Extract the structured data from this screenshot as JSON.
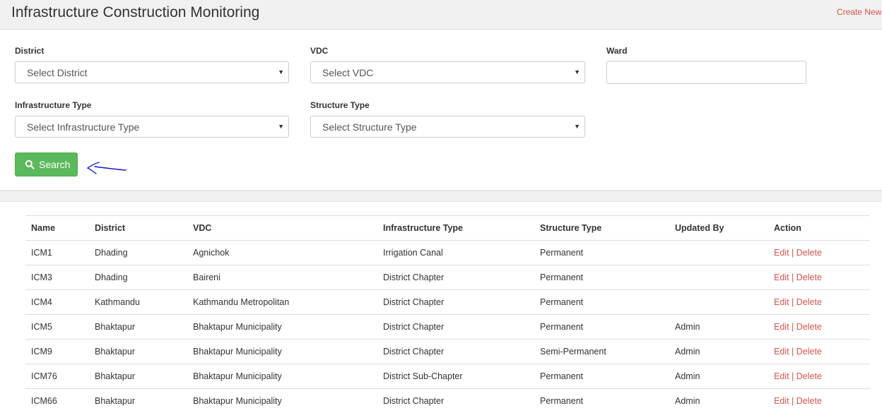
{
  "header": {
    "title": "Infrastructure Construction Monitoring",
    "create_label": "Create New"
  },
  "filters": {
    "district": {
      "label": "District",
      "value": "Select District"
    },
    "vdc": {
      "label": "VDC",
      "value": "Select VDC"
    },
    "ward": {
      "label": "Ward",
      "value": ""
    },
    "infrastructure_type": {
      "label": "Infrastructure Type",
      "value": "Select Infrastructure Type"
    },
    "structure_type": {
      "label": "Structure Type",
      "value": "Select Structure Type"
    },
    "search_label": "Search"
  },
  "table": {
    "columns": [
      "Name",
      "District",
      "VDC",
      "Infrastructure Type",
      "Structure Type",
      "Updated By",
      "Action"
    ],
    "edit_label": "Edit",
    "separator": "|",
    "delete_label": "Delete",
    "rows": [
      {
        "name": "ICM1",
        "district": "Dhading",
        "vdc": "Agnichok",
        "infra": "Irrigation Canal",
        "structure": "Permanent",
        "updated_by": ""
      },
      {
        "name": "ICM3",
        "district": "Dhading",
        "vdc": "Baireni",
        "infra": "District Chapter",
        "structure": "Permanent",
        "updated_by": ""
      },
      {
        "name": "ICM4",
        "district": "Kathmandu",
        "vdc": "Kathmandu Metropolitan",
        "infra": "District Chapter",
        "structure": "Permanent",
        "updated_by": ""
      },
      {
        "name": "ICM5",
        "district": "Bhaktapur",
        "vdc": "Bhaktapur Municipality",
        "infra": "District Chapter",
        "structure": "Permanent",
        "updated_by": "Admin"
      },
      {
        "name": "ICM9",
        "district": "Bhaktapur",
        "vdc": "Bhaktapur Municipality",
        "infra": "District Chapter",
        "structure": "Semi-Permanent",
        "updated_by": "Admin"
      },
      {
        "name": "ICM76",
        "district": "Bhaktapur",
        "vdc": "Bhaktapur Municipality",
        "infra": "District Sub-Chapter",
        "structure": "Permanent",
        "updated_by": "Admin"
      },
      {
        "name": "ICM66",
        "district": "Bhaktapur",
        "vdc": "Bhaktapur Municipality",
        "infra": "District Chapter",
        "structure": "Permanent",
        "updated_by": "Admin"
      }
    ]
  },
  "icons": {
    "search": "search-icon",
    "dropdown": "caret-down-icon",
    "annotation": "hand-drawn-arrow-icon"
  },
  "colors": {
    "accent_red": "#d9534f",
    "search_green": "#5cb85c",
    "annotation_blue": "#1a1acc"
  }
}
